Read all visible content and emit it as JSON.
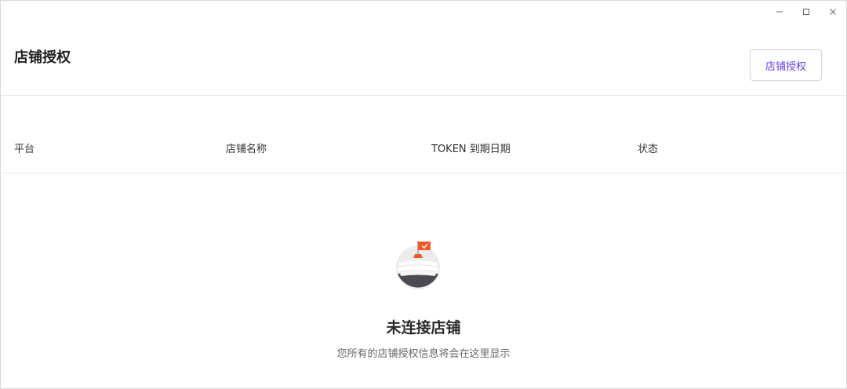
{
  "header": {
    "title": "店铺授权",
    "auth_button_label": "店铺授权"
  },
  "window_controls": {
    "icons": [
      "minimize-icon",
      "maximize-icon",
      "close-icon"
    ]
  },
  "table": {
    "columns": [
      "平台",
      "店铺名称",
      "TOKEN 到期日期",
      "状态"
    ]
  },
  "empty_state": {
    "illustration_icon": "empty-store-flag-icon",
    "title": "未连接店铺",
    "description": "您所有的店铺授权信息将会在这里显示"
  },
  "colors": {
    "accent": "#6a3ef5",
    "flag": "#f05a28",
    "divider": "#e6e6e6"
  }
}
